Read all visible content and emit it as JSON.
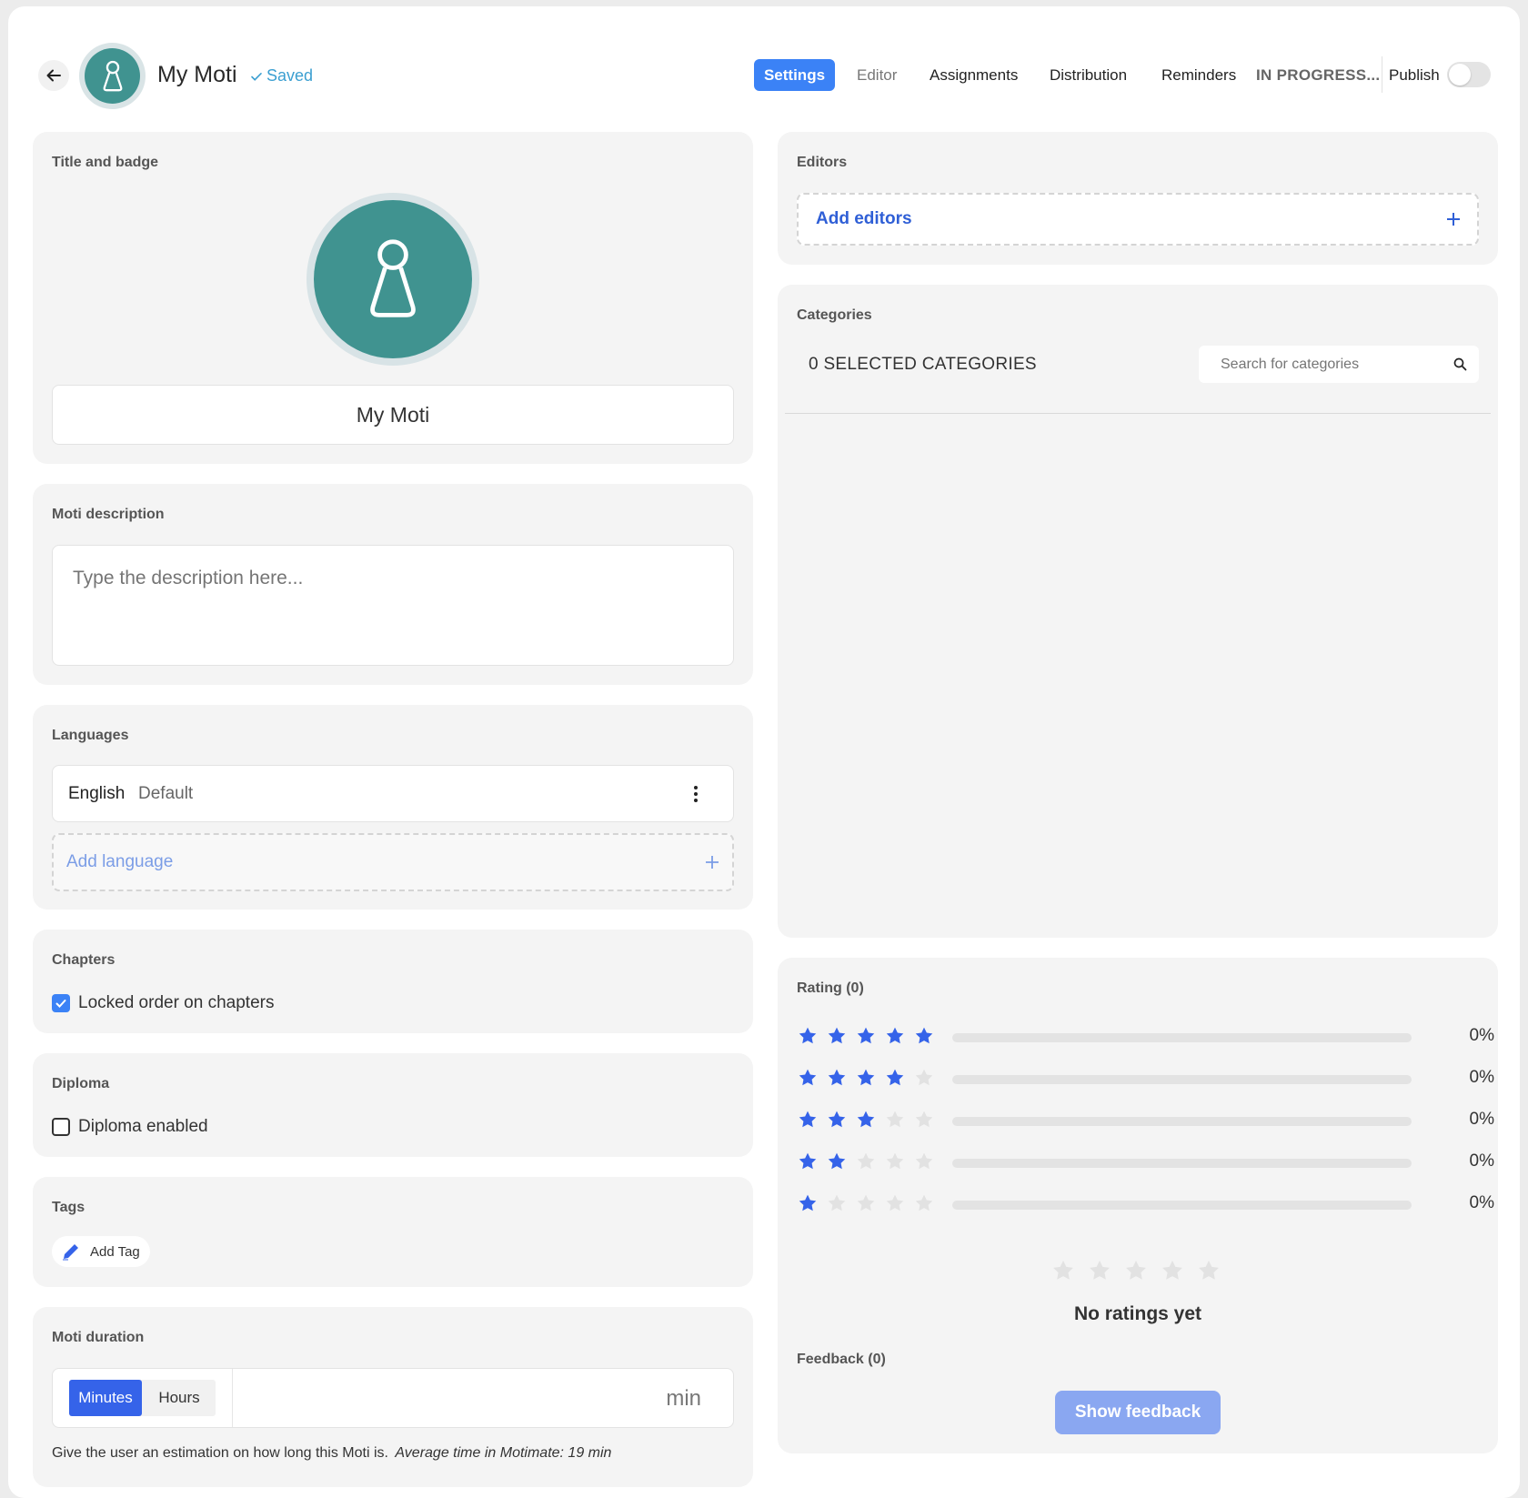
{
  "header": {
    "title": "My Moti",
    "saved_label": "Saved",
    "nav": {
      "settings": "Settings",
      "editor": "Editor",
      "assignments": "Assignments",
      "distribution": "Distribution",
      "reminders": "Reminders",
      "status": "IN PROGRESS...",
      "publish": "Publish"
    },
    "publish_enabled": false
  },
  "title_badge": {
    "label": "Title and badge",
    "title_value": "My Moti",
    "badge_color": "#409390"
  },
  "description": {
    "label": "Moti description",
    "placeholder": "Type the description here...",
    "value": ""
  },
  "languages": {
    "label": "Languages",
    "items": [
      {
        "name": "English",
        "tag": "Default"
      }
    ],
    "add_label": "Add language"
  },
  "chapters": {
    "label": "Chapters",
    "locked_order_label": "Locked order on chapters",
    "locked_order_checked": true
  },
  "diploma": {
    "label": "Diploma",
    "enabled_label": "Diploma enabled",
    "enabled_checked": false
  },
  "tags": {
    "label": "Tags",
    "add_label": "Add Tag"
  },
  "duration": {
    "label": "Moti duration",
    "unit_minutes": "Minutes",
    "unit_hours": "Hours",
    "selected_unit": "Minutes",
    "value": "",
    "suffix": "min",
    "hint": "Give the user an estimation on how long this Moti is.",
    "hint_average": "Average time in Motimate: 19 min"
  },
  "editors": {
    "label": "Editors",
    "add_label": "Add editors"
  },
  "categories": {
    "label": "Categories",
    "selected_count_label": "0 SELECTED CATEGORIES",
    "search_placeholder": "Search for categories"
  },
  "rating": {
    "label": "Rating (0)",
    "rows": [
      {
        "stars": 5,
        "percent_label": "0%",
        "fraction": 0
      },
      {
        "stars": 4,
        "percent_label": "0%",
        "fraction": 0
      },
      {
        "stars": 3,
        "percent_label": "0%",
        "fraction": 0
      },
      {
        "stars": 2,
        "percent_label": "0%",
        "fraction": 0
      },
      {
        "stars": 1,
        "percent_label": "0%",
        "fraction": 0
      }
    ],
    "empty_label": "No ratings yet",
    "feedback_label": "Feedback (0)",
    "show_feedback_label": "Show feedback"
  },
  "colors": {
    "accent": "#3b82f6",
    "star_filled": "#3563e9",
    "star_empty": "#e2e2e2",
    "link_blue": "#2f5fd6",
    "saved": "#3b9fd1"
  }
}
